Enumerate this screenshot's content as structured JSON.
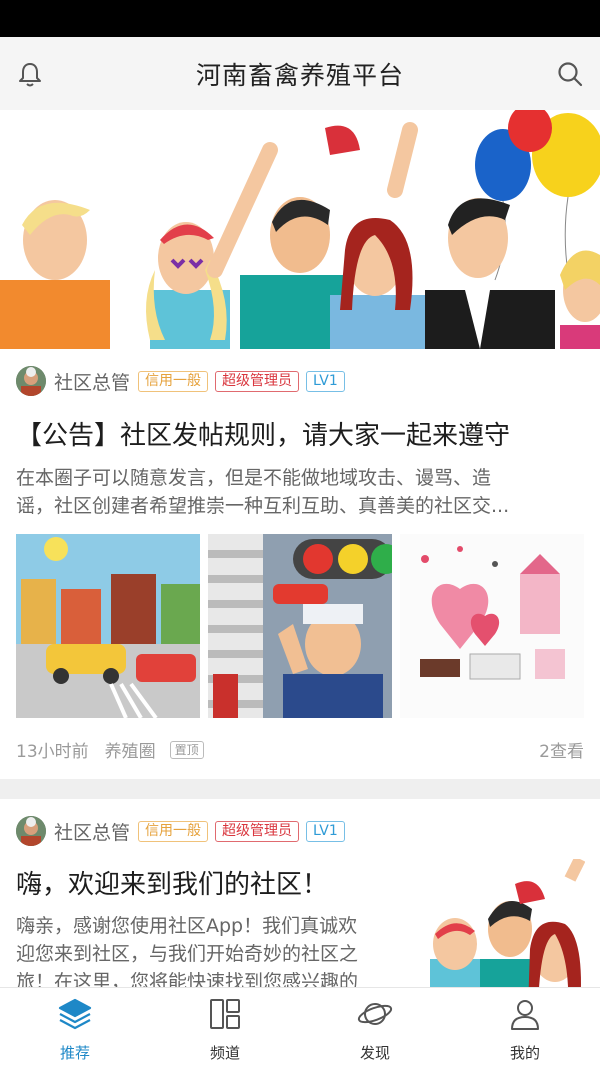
{
  "header": {
    "title": "河南畜禽养殖平台"
  },
  "posts": [
    {
      "author": "社区总管",
      "tags": [
        "信用一般",
        "超级管理员",
        "LV1"
      ],
      "title": "【公告】社区发帖规则，请大家一起来遵守",
      "body_line1": "在本圈子可以随意发言，但是不能做地域攻击、谩骂、造",
      "body_line2": "谣，社区创建者希望推崇一种互利互助、真善美的社区交...",
      "time": "13小时前",
      "circle": "养殖圈",
      "pin": "置顶",
      "views": "2查看"
    },
    {
      "author": "社区总管",
      "tags": [
        "信用一般",
        "超级管理员",
        "LV1"
      ],
      "title": "嗨，欢迎来到我们的社区！",
      "body_line1": "嗨亲，感谢您使用社区App！我们真诚欢",
      "body_line2": "迎您来到社区，与我们开始奇妙的社区之",
      "body_line3": "旅！在这里，您将能快速找到您感兴趣的"
    }
  ],
  "tabs": [
    {
      "label": "推荐",
      "icon": "layers-icon",
      "active": true
    },
    {
      "label": "频道",
      "icon": "grid-icon",
      "active": false
    },
    {
      "label": "发现",
      "icon": "planet-icon",
      "active": false
    },
    {
      "label": "我的",
      "icon": "user-icon",
      "active": false
    }
  ],
  "colors": {
    "accent": "#1e88c7",
    "tag_credit": "#e6a23c",
    "tag_admin": "#d9363e",
    "tag_lv": "#2f9bd6"
  }
}
